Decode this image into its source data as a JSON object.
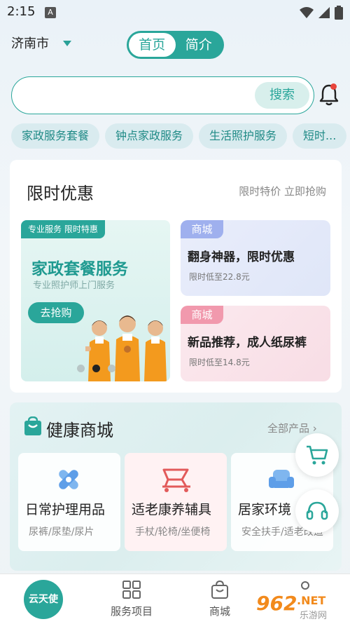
{
  "status_bar": {
    "time": "2:15",
    "notif_icon": "A"
  },
  "header": {
    "city": "济南市",
    "tabs": [
      {
        "label": "首页",
        "active": true
      },
      {
        "label": "简介",
        "active": false
      }
    ]
  },
  "search": {
    "placeholder": "",
    "button_label": "搜索"
  },
  "chips": [
    "家政服务套餐",
    "钟点家政服务",
    "生活照护服务",
    "短时..."
  ],
  "limited_offer": {
    "title": "限时优惠",
    "more": "限时特价 立即抢购",
    "banner": {
      "tag": "专业服务 限时特惠",
      "title": "家政套餐服务",
      "subtitle": "专业照护师上门服务",
      "button": "去抢购"
    },
    "promos": [
      {
        "tag": "商城",
        "title": "翻身神器，限时优惠",
        "subtitle": "限时低至22.8元"
      },
      {
        "tag": "商城",
        "title": "新品推荐，成人纸尿裤",
        "subtitle": "限时低至14.8元"
      }
    ]
  },
  "health_mall": {
    "title": "健康商城",
    "more": "全部产品 ›",
    "categories": [
      {
        "title": "日常护理用品",
        "subtitle": "尿裤/尿垫/尿片",
        "icon": "bandage-icon"
      },
      {
        "title": "适老康养辅具",
        "subtitle": "手杖/轮椅/坐便椅",
        "icon": "wheelchair-icon"
      },
      {
        "title": "居家环境",
        "subtitle": "安全扶手/适老改造",
        "icon": "sofa-icon"
      }
    ]
  },
  "tabbar": {
    "home": "云天使",
    "items": [
      {
        "label": "服务项目"
      },
      {
        "label": "商城"
      },
      {
        "label": ""
      }
    ]
  },
  "watermark": {
    "text": "962.NET",
    "sub": "乐游网"
  },
  "colors": {
    "accent": "#2aa69a",
    "promo_blue": "#9fb0ee",
    "promo_pink": "#f199ad"
  }
}
